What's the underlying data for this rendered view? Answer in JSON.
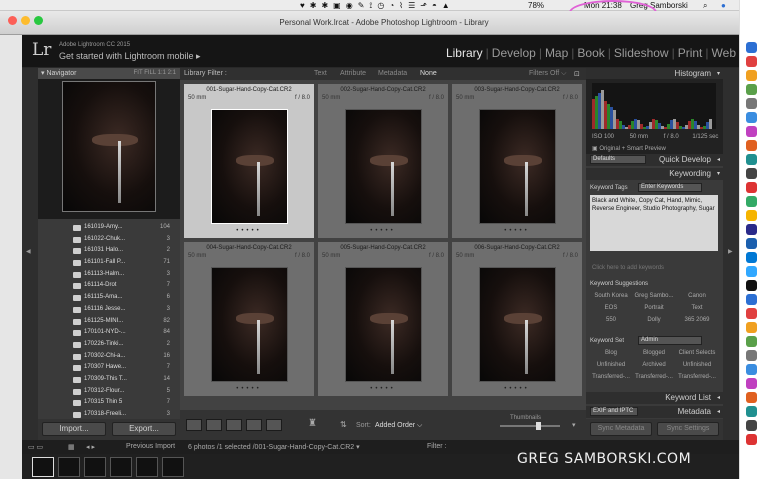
{
  "menubar": {
    "clock": "Mon 21:38",
    "user": "Greg Samborski",
    "battery": "78%"
  },
  "window": {
    "title": "Personal Work.lrcat - Adobe Photoshop Lightroom - Library"
  },
  "identity": {
    "logo": "Lr",
    "version": "Adobe Lightroom CC 2015",
    "mobile": "Get started with Lightroom mobile  ▸"
  },
  "modules": [
    {
      "label": "Library",
      "active": true
    },
    {
      "label": "Develop",
      "active": false
    },
    {
      "label": "Map",
      "active": false
    },
    {
      "label": "Book",
      "active": false
    },
    {
      "label": "Slideshow",
      "active": false
    },
    {
      "label": "Print",
      "active": false
    },
    {
      "label": "Web",
      "active": false
    }
  ],
  "navigator": {
    "title": "Navigator",
    "zoom_options": "FIT  FILL  1:1  2:1"
  },
  "folders": [
    {
      "name": "161019-Amy...",
      "count": "104"
    },
    {
      "name": "161022-Chuk...",
      "count": "3"
    },
    {
      "name": "161031 Halo...",
      "count": "2"
    },
    {
      "name": "161101-Fall P...",
      "count": "71"
    },
    {
      "name": "161113-Halm...",
      "count": "3"
    },
    {
      "name": "161114-Drot",
      "count": "7"
    },
    {
      "name": "161115-Ama...",
      "count": "6"
    },
    {
      "name": "161116 Jesse...",
      "count": "3"
    },
    {
      "name": "161125-MINI...",
      "count": "82"
    },
    {
      "name": "170101-NYD-...",
      "count": "84"
    },
    {
      "name": "170226-Tinki...",
      "count": "2"
    },
    {
      "name": "170302-Chi-a...",
      "count": "16"
    },
    {
      "name": "170307 Hawe...",
      "count": "7"
    },
    {
      "name": "170309-This T...",
      "count": "14"
    },
    {
      "name": "170312-Flour...",
      "count": "5"
    },
    {
      "name": "170315 Thin 5",
      "count": "7"
    },
    {
      "name": "170318-Freeli...",
      "count": "3"
    }
  ],
  "left_buttons": {
    "import": "Import...",
    "export": "Export..."
  },
  "filterbar": {
    "label": "Library Filter :",
    "text": "Text",
    "attribute": "Attribute",
    "metadata": "Metadata",
    "none": "None",
    "filters_off": "Filters Off ⌵"
  },
  "photos": [
    {
      "name": "001-Sugar-Hand-Copy-Cat.CR2",
      "focal": "50 mm",
      "aperture": "f / 8.0",
      "selected": true
    },
    {
      "name": "002-Sugar-Hand-Copy-Cat.CR2",
      "focal": "50 mm",
      "aperture": "f / 8.0",
      "selected": false
    },
    {
      "name": "003-Sugar-Hand-Copy-Cat.CR2",
      "focal": "50 mm",
      "aperture": "f / 8.0",
      "selected": false
    },
    {
      "name": "004-Sugar-Hand-Copy-Cat.CR2",
      "focal": "50 mm",
      "aperture": "f / 8.0",
      "selected": false
    },
    {
      "name": "005-Sugar-Hand-Copy-Cat.CR2",
      "focal": "50 mm",
      "aperture": "f / 8.0",
      "selected": false
    },
    {
      "name": "006-Sugar-Hand-Copy-Cat.CR2",
      "focal": "50 mm",
      "aperture": "f / 8.0",
      "selected": false
    }
  ],
  "toolbar": {
    "sort_label": "Sort:",
    "sort_value": "Added Order ⌵",
    "thumbnails_label": "Thumbnails"
  },
  "histogram": {
    "title": "Histogram",
    "iso": "ISO 100",
    "focal": "50 mm",
    "aperture": "f / 8.0",
    "shutter": "1/125 sec",
    "original": "Original + Smart Preview"
  },
  "quick_develop": {
    "preset": "Defaults",
    "title": "Quick Develop"
  },
  "keywording": {
    "title": "Keywording",
    "tags_label": "Keyword Tags",
    "tags_mode": "Enter Keywords",
    "keywords": "Black and White, Copy Cat, Hand, Mimic, Reverse Engineer, Studio Photography, Sugar",
    "add_placeholder": "Click here to add keywords",
    "suggestions_title": "Keyword Suggestions",
    "suggestions": [
      "South Korea",
      "Greg Sambo...",
      "Canon",
      "EOS",
      "Portrait",
      "Text",
      "550",
      "Dolly",
      "365 2069"
    ],
    "set_label": "Keyword Set",
    "set_value": "Admin",
    "set_items": [
      "Blog",
      "Blogged",
      "Client Selects",
      "Unfinished",
      "Archived",
      "Unfinished",
      "Transferred-...",
      "Transferred-...",
      "Transferred-..."
    ]
  },
  "keyword_list": {
    "title": "Keyword List"
  },
  "metadata": {
    "preset": "EXIF and IPTC",
    "title": "Metadata"
  },
  "right_buttons": {
    "sync_metadata": "Sync Metadata",
    "sync_settings": "Sync Settings"
  },
  "filmstrip_bar": {
    "previous": "Previous Import",
    "info": "6 photos /1 selected /001-Sugar-Hand-Copy-Cat.CR2 ▾",
    "filter": "Filter :"
  },
  "watermark": "GREG SAMBORSKI.COM"
}
